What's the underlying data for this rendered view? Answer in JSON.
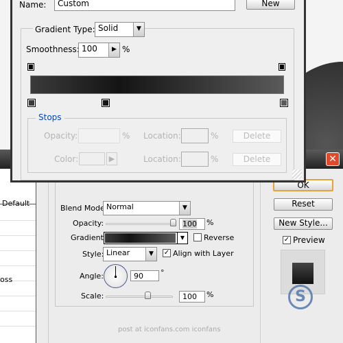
{
  "gradient_editor": {
    "name_label": "Name:",
    "name_value": "Custom",
    "new_button": "New",
    "gradient_type_label": "Gradient Type:",
    "gradient_type_value": "Solid",
    "smoothness_label": "Smoothness:",
    "smoothness_value": "100",
    "percent": "%",
    "gradient_colors": [
      "#3a3a3a",
      "#141414",
      "#5a5a5a"
    ],
    "stops": {
      "title": "Stops",
      "opacity_label": "Opacity:",
      "color_label": "Color:",
      "location_label": "Location:",
      "delete_label": "Delete"
    }
  },
  "layer_style": {
    "list": {
      "item_default": "Default",
      "item_gloss": "oss"
    },
    "blend_mode_label": "Blend Mode:",
    "blend_mode_value": "Normal",
    "opacity_label": "Opacity:",
    "opacity_value": "100",
    "opacity_percent": 100,
    "gradient_label": "Gradient:",
    "reverse_label": "Reverse",
    "reverse_checked": false,
    "style_label": "Style:",
    "style_value": "Linear",
    "align_label": "Align with Layer",
    "align_checked": true,
    "angle_label": "Angle:",
    "angle_value": "90",
    "degree": "°",
    "scale_label": "Scale:",
    "scale_value": "100",
    "scale_percent": 100,
    "percent": "%",
    "ok_button": "OK",
    "reset_button": "Reset",
    "new_style_button": "New Style...",
    "preview_label": "Preview",
    "preview_checked": true,
    "watermark": "post at iconfans.com  iconfans"
  },
  "colors": {
    "accent_blue": "#0046d5",
    "close_red": "#e04a2a"
  }
}
